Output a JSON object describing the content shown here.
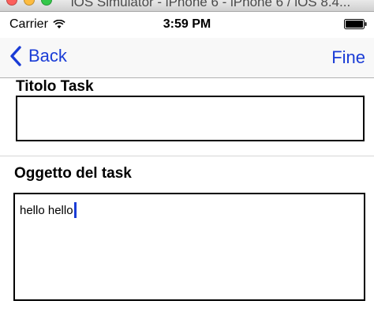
{
  "simulator": {
    "window_title": "iOS Simulator - iPhone 6 - iPhone 6 / iOS 8.4..."
  },
  "status_bar": {
    "carrier": "Carrier",
    "time": "3:59 PM",
    "wifi_icon": "wifi-icon",
    "battery_icon": "battery-icon"
  },
  "nav": {
    "back_label": "Back",
    "done_label": "Fine",
    "back_icon": "chevron-left-icon",
    "tint_color": "#1a3cd6"
  },
  "form": {
    "title_label": "Titolo Task",
    "title_value": "",
    "subject_label": "Oggetto del task",
    "subject_value": "hello hello"
  }
}
